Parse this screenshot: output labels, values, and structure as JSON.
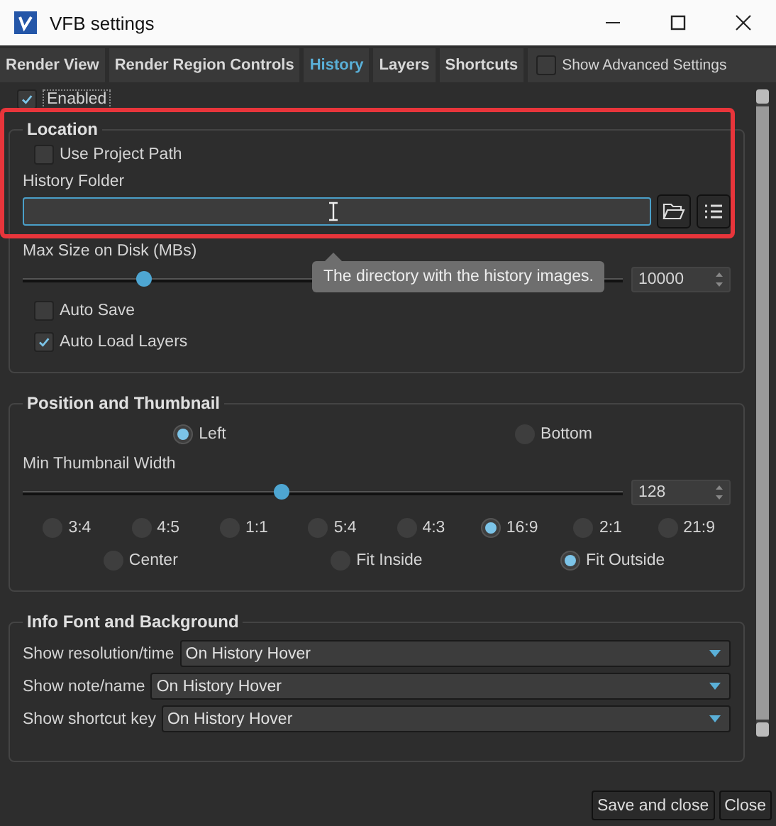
{
  "window": {
    "title": "VFB settings"
  },
  "tabs": [
    {
      "label": "Render View",
      "selected": false
    },
    {
      "label": "Render Region Controls",
      "selected": false
    },
    {
      "label": "History",
      "selected": true
    },
    {
      "label": "Layers",
      "selected": false
    },
    {
      "label": "Shortcuts",
      "selected": false
    }
  ],
  "show_advanced": {
    "label": "Show Advanced Settings",
    "checked": false
  },
  "enabled": {
    "label": "Enabled",
    "checked": true
  },
  "location": {
    "title": "Location",
    "use_project_path": {
      "label": "Use Project Path",
      "checked": false
    },
    "folder_label": "History Folder",
    "tooltip": "The directory with the history images.",
    "max_size": {
      "label": "Max Size on Disk (MBs)",
      "level": 0.2,
      "value": "10000"
    },
    "options": [
      {
        "label": "Auto Save",
        "checked": false
      },
      {
        "label": "Auto Load Layers",
        "checked": true
      }
    ]
  },
  "position": {
    "title": "Position and Thumbnail",
    "placement": [
      {
        "label": "Left",
        "selected": true
      },
      {
        "label": "Bottom",
        "selected": false
      }
    ],
    "width": {
      "label": "Min Thumbnail Width",
      "level": 0.43,
      "value": "128"
    },
    "ratios": [
      {
        "label": "3:4",
        "selected": false
      },
      {
        "label": "4:5",
        "selected": false
      },
      {
        "label": "1:1",
        "selected": false
      },
      {
        "label": "5:4",
        "selected": false
      },
      {
        "label": "4:3",
        "selected": false
      },
      {
        "label": "16:9",
        "selected": true
      },
      {
        "label": "2:1",
        "selected": false
      },
      {
        "label": "21:9",
        "selected": false
      }
    ],
    "fits": [
      {
        "label": "Center",
        "selected": false
      },
      {
        "label": "Fit Inside",
        "selected": false
      },
      {
        "label": "Fit Outside",
        "selected": true
      }
    ]
  },
  "info": {
    "title": "Info Font and Background",
    "rows": [
      {
        "label": "Show resolution/time",
        "value": "On History Hover"
      },
      {
        "label": "Show note/name",
        "value": "On History Hover"
      },
      {
        "label": "Show shortcut key",
        "value": "On History Hover"
      }
    ]
  },
  "buttons": [
    "Save and close",
    "Close"
  ]
}
